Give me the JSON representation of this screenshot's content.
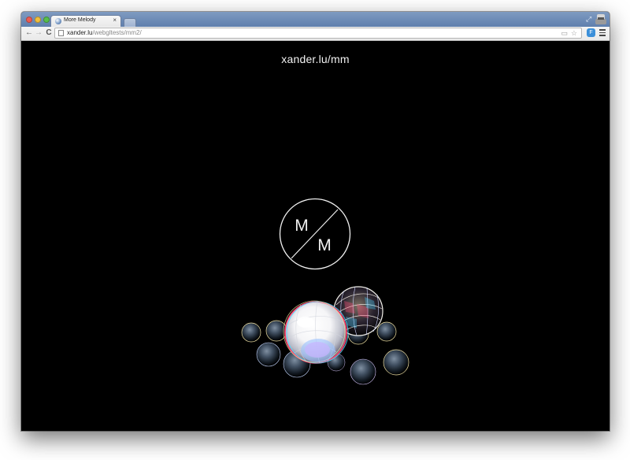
{
  "browser": {
    "tab": {
      "title": "More Melody",
      "close_glyph": "×",
      "favicon_icon": "globe-icon"
    },
    "url": {
      "host": "xander.lu",
      "path": "/webgltests/mm2/"
    },
    "buttons": {
      "back_glyph": "←",
      "forward_glyph": "→",
      "reload_glyph": "C",
      "extension_glyph": "F"
    },
    "colors": {
      "close": "#ee5b52",
      "minimize": "#f1bf3c",
      "maximize": "#58bf4b"
    }
  },
  "page": {
    "title": "xander.lu/mm",
    "logo": {
      "top_letter": "M",
      "bottom_letter": "M"
    }
  }
}
